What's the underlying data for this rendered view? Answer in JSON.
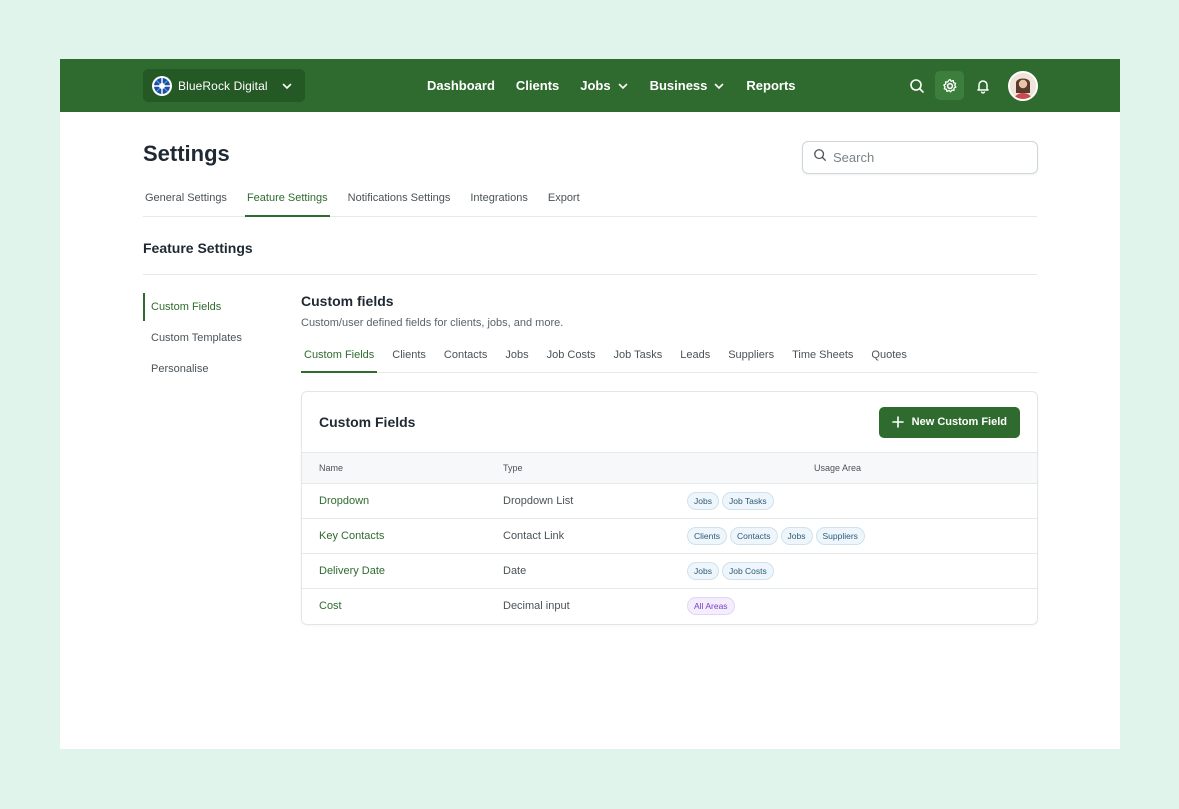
{
  "topbar": {
    "workspace": "BlueRock Digital",
    "nav": [
      {
        "label": "Dashboard",
        "dropdown": false
      },
      {
        "label": "Clients",
        "dropdown": false
      },
      {
        "label": "Jobs",
        "dropdown": true
      },
      {
        "label": "Business",
        "dropdown": true
      },
      {
        "label": "Reports",
        "dropdown": false
      }
    ]
  },
  "page": {
    "title": "Settings",
    "search_placeholder": "Search",
    "tabs": [
      "General Settings",
      "Feature Settings",
      "Notifications Settings",
      "Integrations",
      "Export"
    ],
    "active_tab": "Feature Settings",
    "section_title": "Feature Settings"
  },
  "side": {
    "items": [
      "Custom Fields",
      "Custom Templates",
      "Personalise"
    ],
    "active": "Custom Fields"
  },
  "content": {
    "title": "Custom fields",
    "subtitle": "Custom/user defined fields for clients, jobs, and more.",
    "subtabs": [
      "Custom Fields",
      "Clients",
      "Contacts",
      "Jobs",
      "Job Costs",
      "Job Tasks",
      "Leads",
      "Suppliers",
      "Time Sheets",
      "Quotes"
    ],
    "active_subtab": "Custom Fields"
  },
  "card": {
    "title": "Custom Fields",
    "new_button": "New Custom Field",
    "columns": [
      "Name",
      "Type",
      "Usage Area"
    ],
    "rows": [
      {
        "name": "Dropdown",
        "type": "Dropdown List",
        "areas": [
          "Jobs",
          "Job Tasks"
        ]
      },
      {
        "name": "Key Contacts",
        "type": "Contact Link",
        "areas": [
          "Clients",
          "Contacts",
          "Jobs",
          "Suppliers"
        ]
      },
      {
        "name": "Delivery Date",
        "type": "Date",
        "areas": [
          "Jobs",
          "Job Costs"
        ]
      },
      {
        "name": "Cost",
        "type": "Decimal input",
        "areas": [
          "All Areas"
        ]
      }
    ]
  },
  "colors": {
    "brand": "#2f6b2f",
    "background": "#e0f4eb",
    "tag_blue": "#2c5a7a",
    "tag_purple": "#7a3fc8"
  },
  "icons": {
    "workspace_logo": "globe-logo-icon",
    "search": "search-icon",
    "settings": "gear-icon",
    "notifications": "bell-icon",
    "add": "plus-icon",
    "dropdown": "chevron-down-icon"
  }
}
